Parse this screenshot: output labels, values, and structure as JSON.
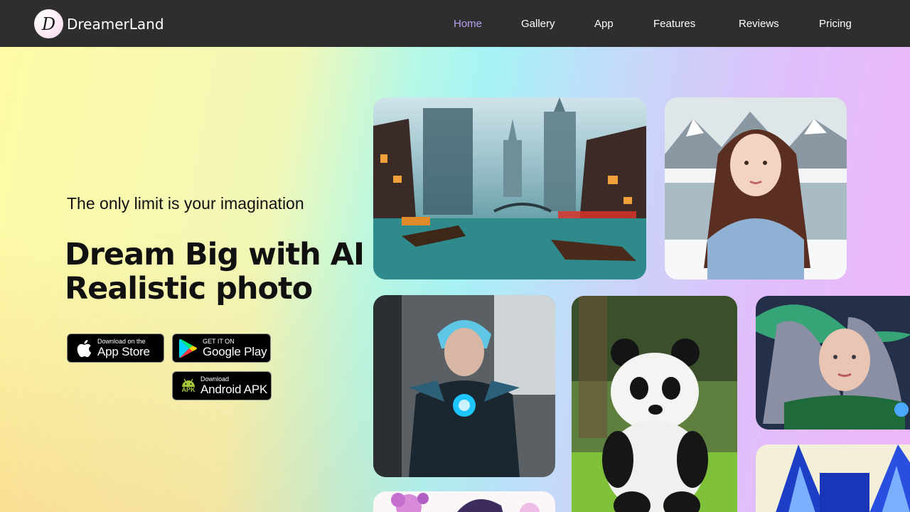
{
  "nav": {
    "logo_letter": "D",
    "brand": "DreamerLand",
    "links": [
      {
        "label": "Home",
        "active": true
      },
      {
        "label": "Gallery",
        "active": false
      },
      {
        "label": "App",
        "active": false
      },
      {
        "label": "Features",
        "active": false
      },
      {
        "label": "Reviews",
        "active": false
      },
      {
        "label": "Pricing",
        "active": false
      }
    ]
  },
  "hero": {
    "tagline": "The only limit is your imagination",
    "headline_line1": "Dream Big with AI For",
    "headline_line2": "Realistic photo"
  },
  "downloads": {
    "appstore": {
      "small": "Download on the",
      "big": "App Store",
      "icon": "apple-icon"
    },
    "googleplay": {
      "small": "GET IT ON",
      "big": "Google Play",
      "icon": "google-play-icon"
    },
    "apk": {
      "small": "Download",
      "big": "Android APK",
      "badge": "APK",
      "icon": "android-icon"
    }
  },
  "gallery": [
    {
      "name": "fantasy-city-canal"
    },
    {
      "name": "woman-snowy-lake"
    },
    {
      "name": "armored-warrior"
    },
    {
      "name": "felt-panda"
    },
    {
      "name": "sorceress-aurora"
    },
    {
      "name": "blue-wolf"
    },
    {
      "name": "anime-girl-flowers"
    }
  ],
  "colors": {
    "navbar_bg": "#2e2e2e",
    "nav_active": "#b8a2ef",
    "nav_text": "#ffffff",
    "hero_gradient": [
      "#fefaa6",
      "#a6f2f6",
      "#f0b6fa"
    ]
  }
}
